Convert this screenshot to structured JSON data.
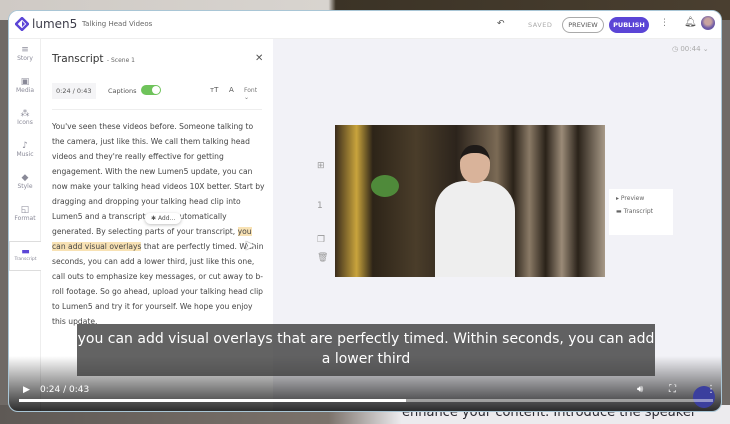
{
  "background": {
    "behind_text": "enhance your content. Introduce the speaker"
  },
  "topbar": {
    "logo": "lumen5",
    "project_title": "Talking Head Videos",
    "saved_label": "SAVED",
    "preview_label": "PREVIEW",
    "publish_label": "PUBLISH",
    "accent": "#5b45d6"
  },
  "rail": {
    "items": [
      {
        "label": "Story",
        "icon": "lines-icon"
      },
      {
        "label": "Media",
        "icon": "image-icon"
      },
      {
        "label": "Icons",
        "icon": "shapes-icon"
      },
      {
        "label": "Music",
        "icon": "note-icon"
      },
      {
        "label": "Style",
        "icon": "paint-icon"
      },
      {
        "label": "Format",
        "icon": "resize-icon"
      },
      {
        "label": "Transcript",
        "icon": "captions-icon"
      }
    ],
    "active": "Transcript"
  },
  "panel": {
    "title": "Transcript",
    "scene": "- Scene 1",
    "time": "0:24 / 0:43",
    "captions_label": "Captions",
    "captions_on": true,
    "font_label": "Font",
    "text_before": "You've seen these videos before. Someone talking to the camera, just like this. We call them talking head videos and they're really effective for getting engagement. With the new Lumen5 update, you can now make your talking head videos 10X better. Start by dragging and dropping your talking head clip into Lumen5 and a transcript will be automatically generated. By selecting parts of your transcript, ",
    "text_highlight": "you can add visual overlays",
    "text_after": " that are perfectly timed. Within seconds, you can add a lower third, just like this one, call outs to emphasize key messages, or cut away to b-roll footage. So go ahead, upload your talking head clip to Lumen5 and try it for yourself. We hope you enjoy this update.",
    "add_bubble": "Add..."
  },
  "canvas": {
    "duration": "00:44",
    "scene_number": "1",
    "context_menu": [
      "Preview",
      "Transcript"
    ]
  },
  "player": {
    "caption_line1": "you can add visual overlays that are perfectly timed. Within seconds, you can add",
    "caption_line2": "a lower third",
    "time": "0:24 / 0:43",
    "progress": 0.558
  }
}
